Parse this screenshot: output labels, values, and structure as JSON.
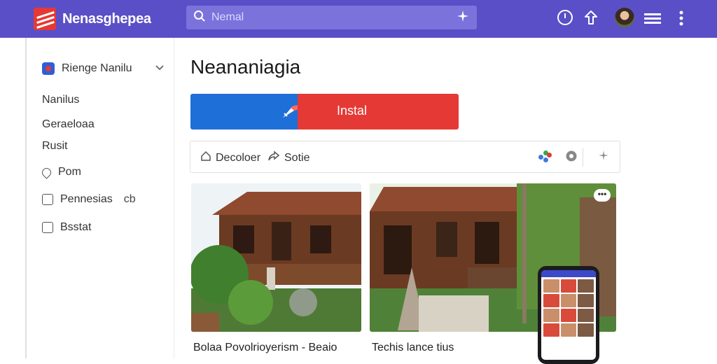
{
  "colors": {
    "header_bg": "#5b4fc7",
    "search_bg": "#7c72dc",
    "install_left": "#1f6fd8",
    "install_right": "#e53935"
  },
  "header": {
    "title": "Nenasghepea",
    "logo_icon": "brand-logo-icon",
    "search_placeholder": "Nemal",
    "icons": [
      "clock-icon",
      "share-icon",
      "avatar",
      "menu-icon",
      "more-vertical-icon"
    ]
  },
  "sidebar": {
    "header_label": "Rienge Nanilu",
    "items": [
      {
        "label": "Nanilus",
        "icon": ""
      },
      {
        "label": "Geraeloaa",
        "icon": ""
      },
      {
        "label": "Rusit",
        "icon": ""
      },
      {
        "label": "Pom",
        "icon": "location-icon"
      },
      {
        "label": "Pennesias",
        "extra": "cb",
        "icon": "file-icon"
      },
      {
        "label": "Bsstat",
        "icon": "checkbox-icon"
      }
    ]
  },
  "main": {
    "title": "Neananiagia",
    "install_label": "Instal",
    "toolbar": {
      "item1": "Decoloer",
      "item2": "Sotie"
    },
    "captions": {
      "card1": "Bolaa Povolrioyerism - Beaio",
      "card2": "Techis lance tius"
    }
  }
}
